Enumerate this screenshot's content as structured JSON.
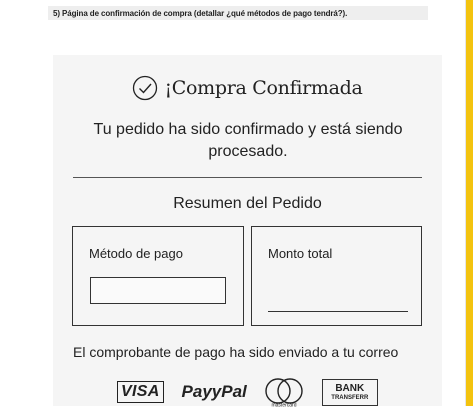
{
  "header": {
    "note": "5) Página de confirmación de compra (detallar ¿qué métodos de pago tendrá?)."
  },
  "confirmation": {
    "title": "¡Compra Confirmada",
    "subtitle": "Tu pedido ha sido confirmado y está siendo procesado.",
    "summary_title": "Resumen del Pedido",
    "payment_method_label": "Método de pago",
    "payment_method_value": "",
    "total_label": "Monto total",
    "total_value": "",
    "notice": "El comprobante de pago ha sido enviado a tu correo"
  },
  "payment_methods": {
    "visa": "VISA",
    "paypal": "PayyPal",
    "mastercard": "mastercard",
    "bank_line1": "BANK",
    "bank_line2": "TRANSFERR"
  },
  "colors": {
    "accent_stripe": "#f3c30f",
    "card_background": "#f5f5f5"
  },
  "icons": [
    "check-circle-icon",
    "mastercard-icon"
  ]
}
